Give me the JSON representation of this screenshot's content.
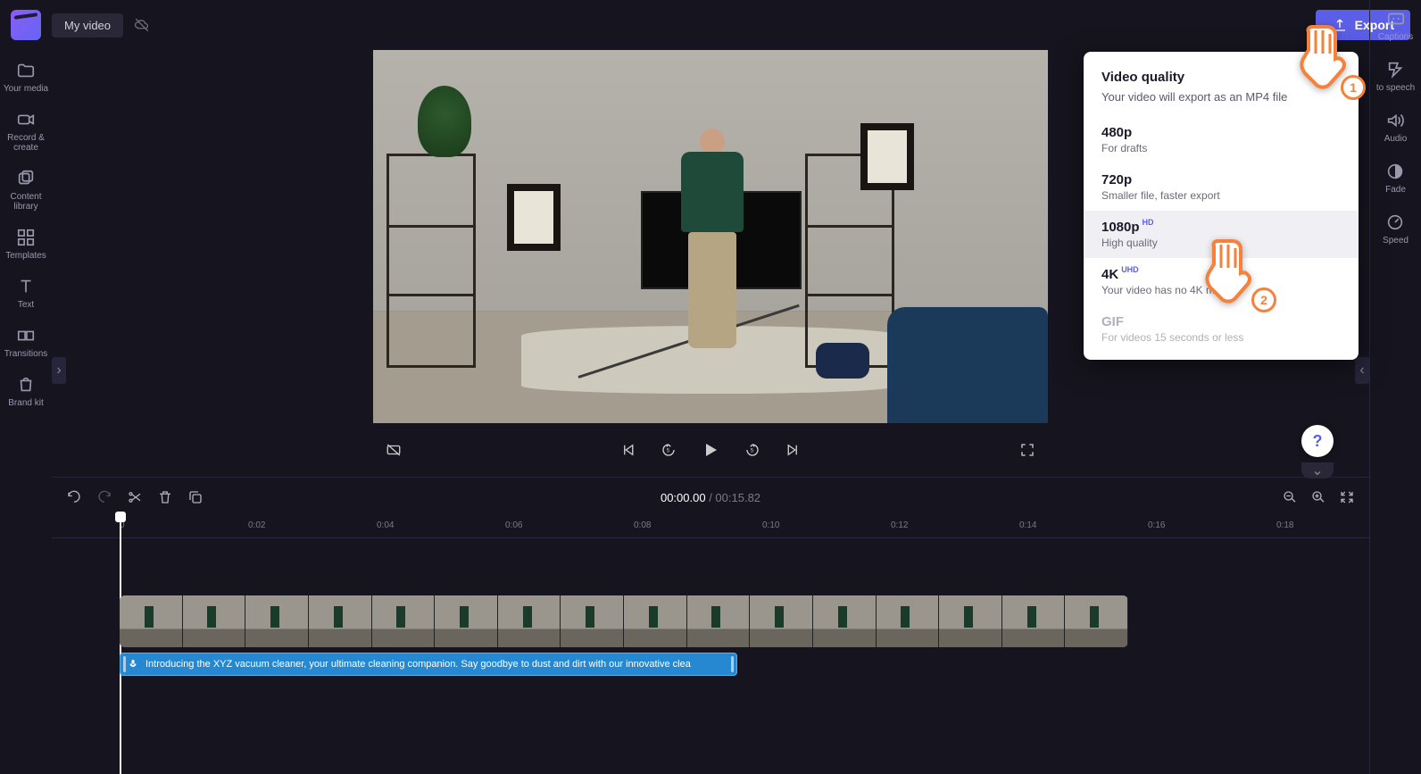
{
  "header": {
    "project_title": "My video",
    "export_label": "Export"
  },
  "left_rail": [
    {
      "label": "Your media"
    },
    {
      "label": "Record & create"
    },
    {
      "label": "Content library"
    },
    {
      "label": "Templates"
    },
    {
      "label": "Text"
    },
    {
      "label": "Transitions"
    },
    {
      "label": "Brand kit"
    }
  ],
  "right_rail": [
    {
      "label": "Captions"
    },
    {
      "label": "to speech"
    },
    {
      "label": "Audio"
    },
    {
      "label": "Fade"
    },
    {
      "label": "Speed"
    }
  ],
  "export_popup": {
    "title": "Video quality",
    "subtitle": "Your video will export as an MP4 file",
    "options": [
      {
        "label": "480p",
        "desc": "For drafts",
        "badge": ""
      },
      {
        "label": "720p",
        "desc": "Smaller file, faster export",
        "badge": ""
      },
      {
        "label": "1080p",
        "desc": "High quality",
        "badge": "HD"
      },
      {
        "label": "4K",
        "desc": "Your video has no 4K media",
        "badge": "UHD"
      },
      {
        "label": "GIF",
        "desc": "For videos 15 seconds or less",
        "badge": ""
      }
    ]
  },
  "timeline": {
    "current": "00:00.00",
    "duration": "00:15.82",
    "ticks": [
      "0",
      "0:02",
      "0:04",
      "0:06",
      "0:08",
      "0:10",
      "0:12",
      "0:14",
      "0:16",
      "0:18"
    ],
    "audio_text": "Introducing the XYZ vacuum cleaner, your ultimate cleaning companion. Say goodbye to dust and dirt with our innovative clea"
  },
  "annotations": {
    "p1": "1",
    "p2": "2"
  },
  "help": "?"
}
